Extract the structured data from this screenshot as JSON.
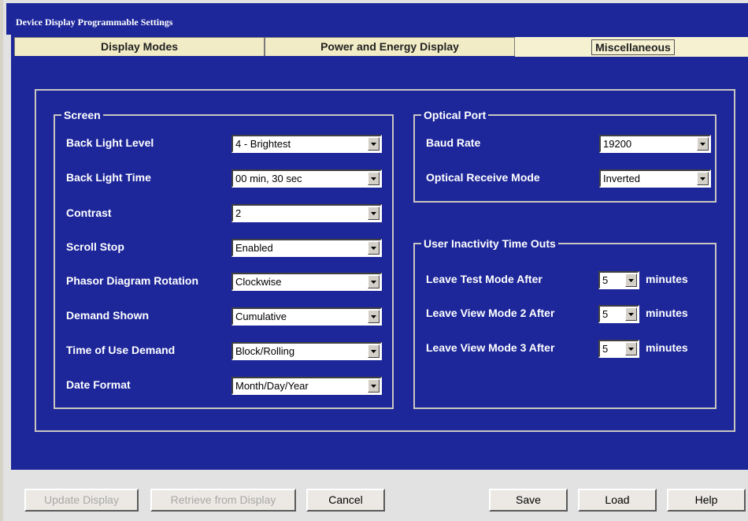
{
  "window": {
    "title": "Device Display Programmable Settings"
  },
  "tabs": [
    {
      "label": "Display Modes"
    },
    {
      "label": "Power and Energy Display"
    },
    {
      "label": "Miscellaneous"
    }
  ],
  "screen": {
    "legend": "Screen",
    "rows": [
      {
        "label": "Back Light Level",
        "value": "4 - Brightest"
      },
      {
        "label": "Back Light Time",
        "value": "00 min, 30 sec"
      },
      {
        "label": "Contrast",
        "value": "2"
      },
      {
        "label": "Scroll Stop",
        "value": "Enabled"
      },
      {
        "label": "Phasor Diagram Rotation",
        "value": "Clockwise"
      },
      {
        "label": "Demand Shown",
        "value": "Cumulative"
      },
      {
        "label": "Time of Use Demand",
        "value": "Block/Rolling"
      },
      {
        "label": "Date Format",
        "value": "Month/Day/Year"
      }
    ]
  },
  "optical_port": {
    "legend": "Optical Port",
    "rows": [
      {
        "label": "Baud Rate",
        "value": "19200"
      },
      {
        "label": "Optical Receive Mode",
        "value": "Inverted"
      }
    ]
  },
  "inactivity": {
    "legend": "User Inactivity Time Outs",
    "rows": [
      {
        "label": "Leave Test Mode After",
        "value": "5",
        "unit": "minutes"
      },
      {
        "label": "Leave View Mode 2 After",
        "value": "5",
        "unit": "minutes"
      },
      {
        "label": "Leave View Mode 3 After",
        "value": "5",
        "unit": "minutes"
      }
    ]
  },
  "buttons": {
    "update_display": "Update Display",
    "retrieve": "Retrieve from Display",
    "cancel": "Cancel",
    "save": "Save",
    "load": "Load",
    "help": "Help"
  },
  "colors": {
    "panel_background": "#1d279a",
    "tab_background": "#f2ecc6",
    "label_text": "#ffffff"
  }
}
